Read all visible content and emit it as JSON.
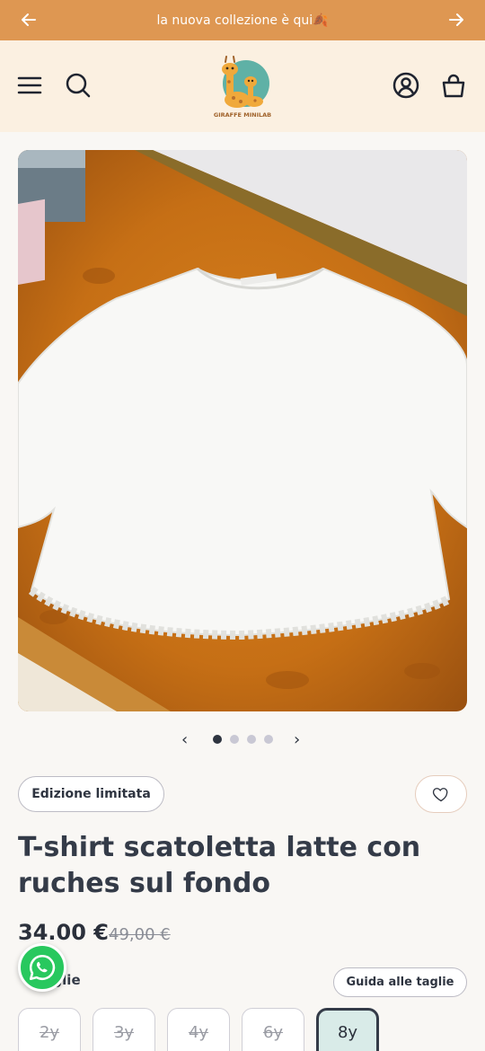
{
  "announcement": {
    "text": "la nuova collezione è qui🍂"
  },
  "brand": {
    "logo_text": "GIRAFFE MINILAB"
  },
  "product": {
    "badge": "Edizione limitata",
    "title": "T-shirt scatoletta latte con ruches sul fondo",
    "price": "34.00 €",
    "compare_price": "49,00 €"
  },
  "gallery": {
    "prev": "‹",
    "next": "›",
    "slide_count": 4,
    "active_index": 0
  },
  "size": {
    "label": "Taglie",
    "guide_label": "Guida alle taglie",
    "options": [
      {
        "label": "2y",
        "available": false
      },
      {
        "label": "3y",
        "available": false
      },
      {
        "label": "4y",
        "available": false
      },
      {
        "label": "6y",
        "available": false
      },
      {
        "label": "8y",
        "available": true,
        "selected": true
      }
    ]
  },
  "colors": {
    "announcement_bg": "#de9752",
    "header_bg": "#fbf0e1",
    "text": "#2e3440",
    "selected_size_bg": "#d9ebe8",
    "whatsapp": "#28c85e"
  }
}
